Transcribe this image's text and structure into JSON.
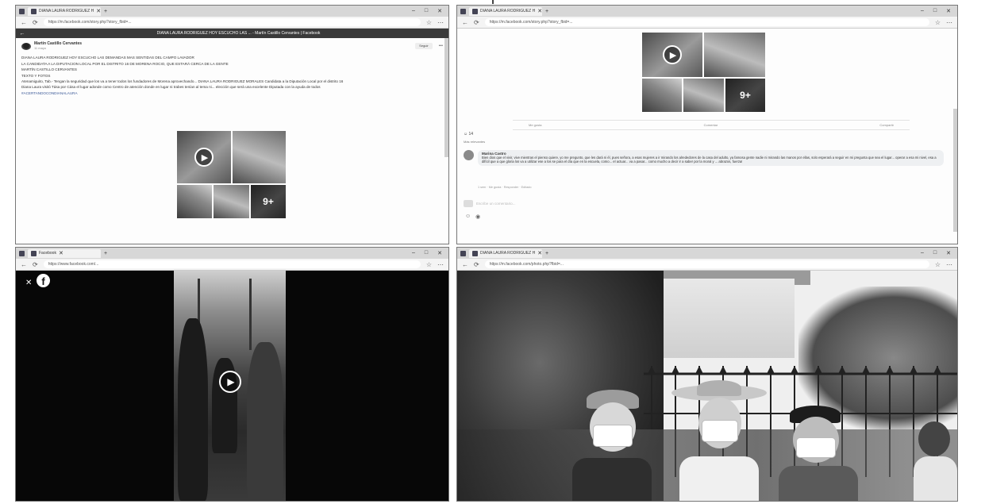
{
  "panel1": {
    "tab_title": "DIANA LAURA RODRIGUEZ H",
    "url": "https://m.facebook.com/story.php?story_fbid=...",
    "fb_bar_title": "DIANA LAURA RODRIGUEZ HOY ESCUCHO LAS ... - Martín Castillo Cervantes | Facebook",
    "author": "Martín Castillo Cervantes",
    "time": "11 mayo",
    "follow": "Seguir",
    "lines": [
      "DIANA LAURA RODRIGUEZ HOY ESCUCHO LAS DEMANDAS MAS SENTIDAS DEL CAMPO LAVADOR",
      "LA CANDIDATA A LA DIPUTACION LOCAL POR EL DISTRITO 16 DE MORENA ROCIO, QUE ESTARÁ CERCA DE LA GENTE",
      "MARTÍN CASTILLO CERVANTES",
      "TEXTO Y FOTOS",
      "Atenamiguito, Tab.- Tengan la seguridad que los va a tener todos los fundadores de Morena aprovechando... DIANA LAURA RODRIGUEZ MORALES Candidata a la Diputación Local por el distrito 16",
      "Diana Laura visitó Tása por Cása el lugar adonde como Centro de atención donde en lugar ni trabes tenían al tema ni... elección que será una excelente Diputada con la ayuda de todos"
    ],
    "hashtags": "#ACERTANDOCONDIANALAURA"
  },
  "panel2": {
    "tab_title": "DIANA LAURA RODRIGUEZ H",
    "url": "https://m.facebook.com/story.php?story_fbid=...",
    "actions": [
      "Me gusta",
      "Comentar",
      "Compartir"
    ],
    "reactions_count": "14",
    "sort_label": "Más relevantes",
    "commenter": "Marina Castro",
    "comment": "Bien dios que el vivir, vive mientras el pienso quiere, yo me pregunto, que les dará ni él, pues señora, a esas mujeres a ir mirando los alrededores de la casa del adulto, ya famosa gente nadie ni mirando las manos por ellas, solo esperará a seguir en mi pregunta que sea el lugar... operar a esa mi nivel, esa a difícil que a que gloria los va a utilizar ese a los se para el día que en la escuela, como... el actuar... va a pasar... como mucho a decir ir a saber por la moral y ... abrazos, fuerza!",
    "comment_meta": "1 sem  ·  Me gusta  ·  Responder  ·  Editado",
    "write_placeholder": "Escribe un comentario..."
  },
  "panel3": {
    "tab_title": "Facebook",
    "url": "https://www.facebook.com/...",
    "logo_letter": "f",
    "close": "✕"
  },
  "panel4": {
    "tab_title": "DIANA LAURA RODRIGUEZ H",
    "url": "https://m.facebook.com/photo.php?fbid=..."
  },
  "icons": {
    "play": "▶",
    "back": "←",
    "forward": "→",
    "reload": "⟳",
    "close": "✕",
    "more_overlay": "9+"
  },
  "colors": {
    "fb_blue": "#3b5998",
    "tab_bg": "#d7d7d7"
  }
}
